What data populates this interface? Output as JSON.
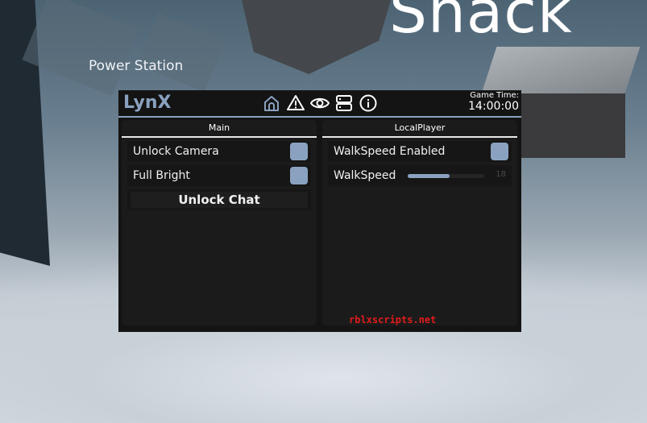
{
  "world": {
    "location_label": "Shack",
    "sublocation_label": "Power Station"
  },
  "window": {
    "title": "LynX",
    "accent_color": "#8aa2c0",
    "top_icons": [
      "home-icon",
      "warning-icon",
      "eye-icon",
      "server-icon",
      "info-icon"
    ],
    "game_time": {
      "label": "Game Time:",
      "value": "14:00:00"
    }
  },
  "panels": {
    "main": {
      "header": "Main",
      "toggles": [
        {
          "label": "Unlock Camera",
          "enabled": true
        },
        {
          "label": "Full Bright",
          "enabled": true
        }
      ],
      "button": {
        "label": "Unlock Chat"
      }
    },
    "local_player": {
      "header": "LocalPlayer",
      "toggles": [
        {
          "label": "WalkSpeed Enabled",
          "enabled": true
        }
      ],
      "slider": {
        "label": "WalkSpeed",
        "value": "18",
        "fill_fraction": 0.55
      }
    }
  },
  "watermark": "rblxscripts.net"
}
